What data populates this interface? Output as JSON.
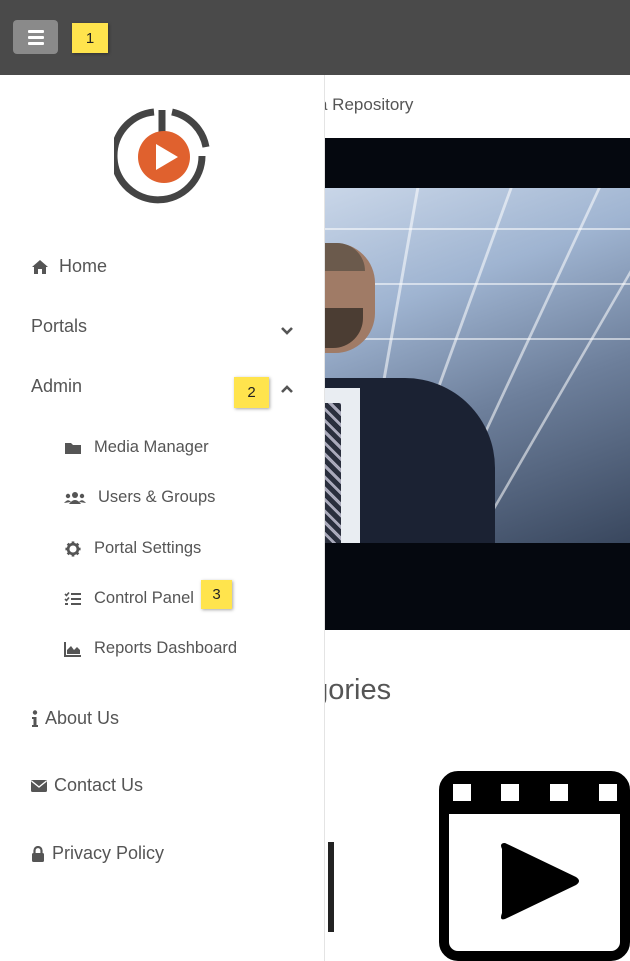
{
  "topbar": {
    "menu_button_icon": "hamburger-icon",
    "badge_1": "1"
  },
  "background_page": {
    "title_fragment": "a Repository",
    "heading_fragment": "egories",
    "video_icon": "film-play-icon"
  },
  "sidebar": {
    "logo_icon": "play-logo-icon",
    "accent_color": "#e0612e",
    "items": [
      {
        "label": "Home",
        "icon": "home-icon"
      },
      {
        "label": "Portals",
        "icon": "chevron-down-icon"
      },
      {
        "label": "Admin",
        "icon": "chevron-up-icon"
      }
    ],
    "admin_submenu": [
      {
        "label": "Media Manager",
        "icon": "folder-icon"
      },
      {
        "label": "Users & Groups",
        "icon": "users-icon"
      },
      {
        "label": "Portal Settings",
        "icon": "gear-icon"
      },
      {
        "label": "Control Panel",
        "icon": "list-check-icon"
      },
      {
        "label": "Reports Dashboard",
        "icon": "area-chart-icon"
      }
    ],
    "footer_links": [
      {
        "label": "About Us",
        "icon": "info-icon"
      },
      {
        "label": "Contact Us",
        "icon": "envelope-icon"
      },
      {
        "label": "Privacy Policy",
        "icon": "lock-icon"
      }
    ]
  },
  "badges": {
    "badge_2": "2",
    "badge_3": "3"
  }
}
